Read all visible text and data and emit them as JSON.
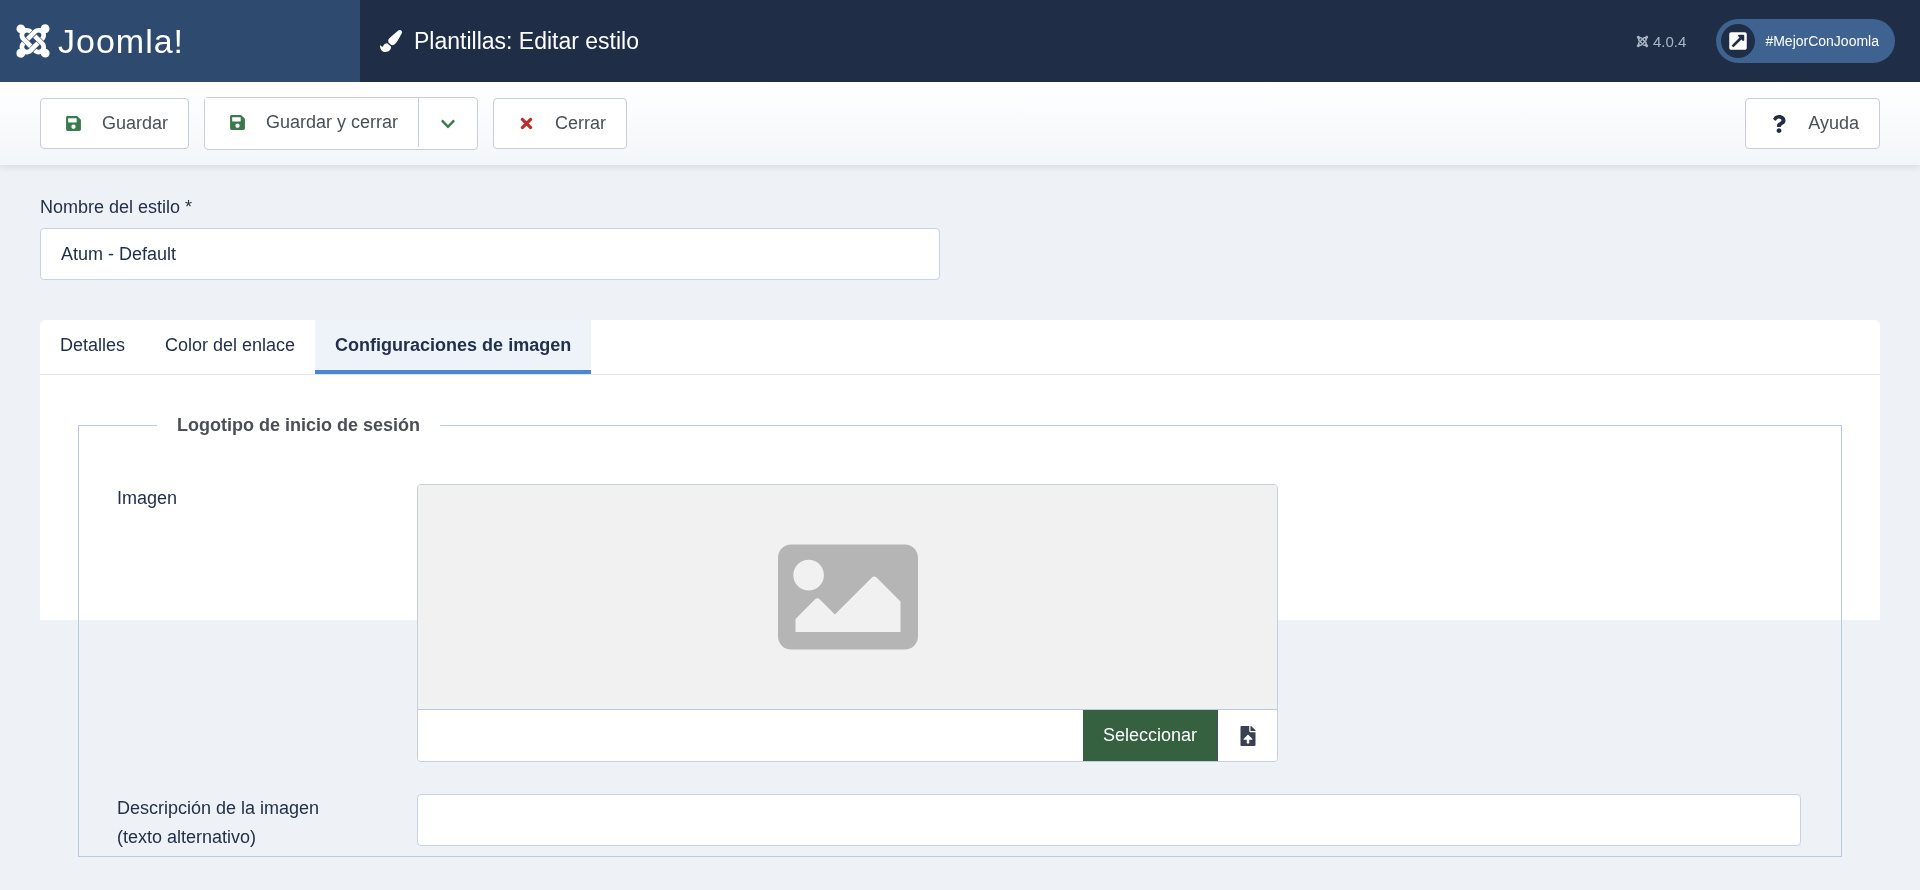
{
  "header": {
    "brand": "Joomla!",
    "title": "Plantillas: Editar estilo",
    "version": "4.0.4",
    "promo": "#MejorConJoomla"
  },
  "toolbar": {
    "buttons": [
      {
        "kind": "save",
        "label": "Guardar"
      },
      {
        "kind": "save-split",
        "label": "Guardar y cerrar"
      },
      {
        "kind": "close",
        "label": "Cerrar"
      }
    ],
    "help": "Ayuda"
  },
  "style_name": {
    "label": "Nombre del estilo *",
    "value": "Atum - Default"
  },
  "tabs": [
    {
      "label": "Detalles",
      "selected": false
    },
    {
      "label": "Color del enlace",
      "selected": false
    },
    {
      "label": "Configuraciones de imagen",
      "selected": true
    }
  ],
  "fieldset": {
    "legend": "Logotipo de inicio de sesión",
    "image": {
      "label": "Imagen",
      "button": "Seleccionar"
    },
    "alt": {
      "label": "Descripción de la imagen\n(texto alternativo)"
    }
  }
}
